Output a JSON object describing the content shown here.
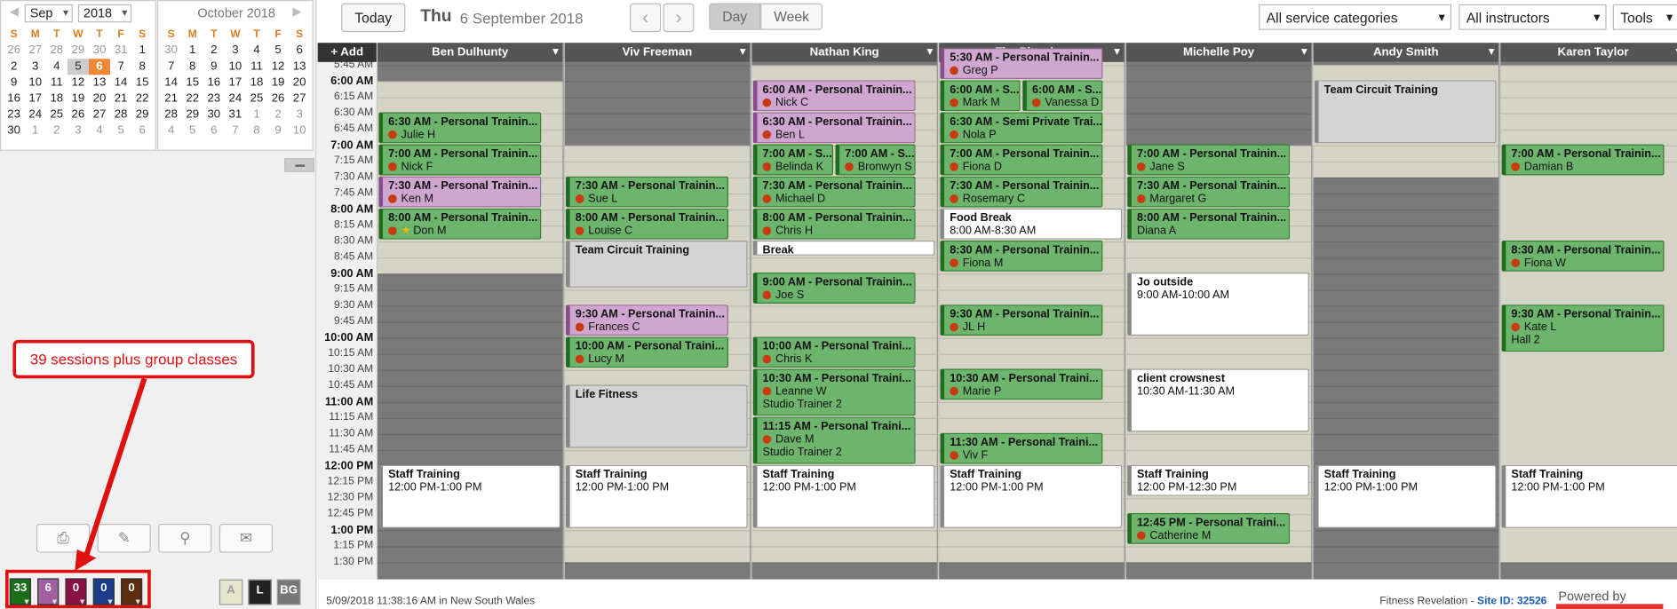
{
  "mini_cal_left": {
    "month": "Sep",
    "year": "2018",
    "dow": [
      "S",
      "M",
      "T",
      "W",
      "T",
      "F",
      "S"
    ],
    "days": [
      "26",
      "27",
      "28",
      "29",
      "30",
      "31",
      "1",
      "2",
      "3",
      "4",
      "5",
      "6",
      "7",
      "8",
      "9",
      "10",
      "11",
      "12",
      "13",
      "14",
      "15",
      "16",
      "17",
      "18",
      "19",
      "20",
      "21",
      "22",
      "23",
      "24",
      "25",
      "26",
      "27",
      "28",
      "29",
      "30",
      "1",
      "2",
      "3",
      "4",
      "5",
      "6"
    ]
  },
  "mini_cal_right": {
    "title": "October 2018",
    "dow": [
      "S",
      "M",
      "T",
      "W",
      "T",
      "F",
      "S"
    ],
    "days": [
      "30",
      "1",
      "2",
      "3",
      "4",
      "5",
      "6",
      "7",
      "8",
      "9",
      "10",
      "11",
      "12",
      "13",
      "14",
      "15",
      "16",
      "17",
      "18",
      "19",
      "20",
      "21",
      "22",
      "23",
      "24",
      "25",
      "26",
      "27",
      "28",
      "29",
      "30",
      "31",
      "1",
      "2",
      "3",
      "4",
      "5",
      "6",
      "7",
      "8",
      "9",
      "10"
    ]
  },
  "tool_icons": [
    "print-icon",
    "edit-icon",
    "search-icon",
    "mail-icon"
  ],
  "counts": [
    {
      "value": "33",
      "color": "#1a6e1a"
    },
    {
      "value": "6",
      "color": "#a060a0"
    },
    {
      "value": "0",
      "color": "#8a1044"
    },
    {
      "value": "0",
      "color": "#1a3c8a"
    },
    {
      "value": "0",
      "color": "#5a2e0e"
    }
  ],
  "legend": [
    {
      "label": "A",
      "bg": "#e6e6cc",
      "fg": "#999"
    },
    {
      "label": "L",
      "bg": "#222",
      "fg": "#fff"
    },
    {
      "label": "BG",
      "bg": "#777",
      "fg": "#fff"
    }
  ],
  "callout": "39 sessions plus group classes",
  "toolbar": {
    "today": "Today",
    "day_name": "Thu",
    "date": "6 September 2018",
    "view_day": "Day",
    "view_week": "Week",
    "service_categories": "All service categories",
    "instructors": "All instructors",
    "tools": "Tools"
  },
  "add_label": "+ Add",
  "instructors": [
    "Ben Dulhunty",
    "Viv Freeman",
    "Nathan King",
    "Tim Pittorino",
    "Michelle Poy",
    "Andy Smith",
    "Karen Taylor"
  ],
  "times": [
    "5:45 AM",
    "6:00 AM",
    "6:15 AM",
    "6:30 AM",
    "6:45 AM",
    "7:00 AM",
    "7:15 AM",
    "7:30 AM",
    "7:45 AM",
    "8:00 AM",
    "8:15 AM",
    "8:30 AM",
    "8:45 AM",
    "9:00 AM",
    "9:15 AM",
    "9:30 AM",
    "9:45 AM",
    "10:00 AM",
    "10:15 AM",
    "10:30 AM",
    "10:45 AM",
    "11:00 AM",
    "11:15 AM",
    "11:30 AM",
    "11:45 AM",
    "12:00 PM",
    "12:15 PM",
    "12:30 PM",
    "12:45 PM",
    "1:00 PM",
    "1:15 PM",
    "1:30 PM"
  ],
  "events": [
    {
      "col": 0,
      "title": "6:30 AM - Personal Trainin...",
      "client": "Julie H",
      "style": "green"
    },
    {
      "col": 0,
      "title": "7:00 AM - Personal Trainin...",
      "client": "Nick F",
      "style": "green"
    },
    {
      "col": 0,
      "title": "7:30 AM - Personal Trainin...",
      "client": "Ken M",
      "style": "purple"
    },
    {
      "col": 0,
      "title": "8:00 AM - Personal Trainin...",
      "client": "Don M",
      "style": "green",
      "star": true
    },
    {
      "col": 0,
      "title": "Staff Training",
      "client": "12:00 PM-1:00 PM",
      "style": "white",
      "nodot": true
    },
    {
      "col": 1,
      "title": "7:30 AM - Personal Trainin...",
      "client": "Sue L",
      "style": "green"
    },
    {
      "col": 1,
      "title": "8:00 AM - Personal Trainin...",
      "client": "Louise C",
      "style": "green"
    },
    {
      "col": 1,
      "title": "Team Circuit Training",
      "client": "",
      "style": "grey",
      "nodot": true
    },
    {
      "col": 1,
      "title": "9:30 AM - Personal Trainin...",
      "client": "Frances C",
      "style": "purple"
    },
    {
      "col": 1,
      "title": "10:00 AM - Personal Traini...",
      "client": "Lucy M",
      "style": "green"
    },
    {
      "col": 1,
      "title": "Life Fitness",
      "client": "",
      "style": "grey",
      "nodot": true
    },
    {
      "col": 1,
      "title": "Staff Training",
      "client": "12:00 PM-1:00 PM",
      "style": "white",
      "nodot": true
    },
    {
      "col": 2,
      "title": "6:00 AM - Personal Trainin...",
      "client": "Nick C",
      "style": "purple"
    },
    {
      "col": 2,
      "title": "6:30 AM - Personal Trainin...",
      "client": "Ben L",
      "style": "purple"
    },
    {
      "col": 2,
      "title": "7:00 AM - S...",
      "client": "Belinda K",
      "style": "green"
    },
    {
      "col": 2,
      "title": "7:00 AM - S...",
      "client": "Bronwyn S",
      "style": "green"
    },
    {
      "col": 2,
      "title": "7:30 AM - Personal Trainin...",
      "client": "Michael D",
      "style": "green"
    },
    {
      "col": 2,
      "title": "8:00 AM - Personal Trainin...",
      "client": "Chris H",
      "style": "green"
    },
    {
      "col": 2,
      "title": "Break",
      "client": "",
      "style": "white",
      "nodot": true
    },
    {
      "col": 2,
      "title": "9:00 AM - Personal Trainin...",
      "client": "Joe S",
      "style": "green"
    },
    {
      "col": 2,
      "title": "10:00 AM - Personal Traini...",
      "client": "Chris K",
      "style": "green"
    },
    {
      "col": 2,
      "title": "10:30 AM - Personal Traini...",
      "client": "Leanne W",
      "extra": "Studio Trainer 2",
      "style": "green"
    },
    {
      "col": 2,
      "title": "11:15 AM - Personal Traini...",
      "client": "Dave M",
      "extra": "Studio Trainer 2",
      "style": "green"
    },
    {
      "col": 2,
      "title": "Staff Training",
      "client": "12:00 PM-1:00 PM",
      "style": "white",
      "nodot": true
    },
    {
      "col": 3,
      "title": "5:30 AM - Personal Trainin...",
      "client": "Greg P",
      "style": "purple"
    },
    {
      "col": 3,
      "title": "6:00 AM - S...",
      "client": "Mark M",
      "style": "green"
    },
    {
      "col": 3,
      "title": "6:00 AM - S...",
      "client": "Vanessa D",
      "style": "green"
    },
    {
      "col": 3,
      "title": "6:30 AM - Semi Private Trai...",
      "client": "Nola P",
      "style": "green"
    },
    {
      "col": 3,
      "title": "7:00 AM - Personal Trainin...",
      "client": "Fiona D",
      "style": "green"
    },
    {
      "col": 3,
      "title": "7:30 AM - Personal Trainin...",
      "client": "Rosemary C",
      "style": "green"
    },
    {
      "col": 3,
      "title": "Food Break",
      "client": "8:00 AM-8:30 AM",
      "style": "white",
      "nodot": true
    },
    {
      "col": 3,
      "title": "8:30 AM - Personal Trainin...",
      "client": "Fiona M",
      "style": "green"
    },
    {
      "col": 3,
      "title": "9:30 AM - Personal Trainin...",
      "client": "JL H",
      "style": "green"
    },
    {
      "col": 3,
      "title": "10:30 AM - Personal Traini...",
      "client": "Marie P",
      "style": "green"
    },
    {
      "col": 3,
      "title": "11:30 AM - Personal Traini...",
      "client": "Viv F",
      "style": "green"
    },
    {
      "col": 3,
      "title": "Staff Training",
      "client": "12:00 PM-1:00 PM",
      "style": "white",
      "nodot": true
    },
    {
      "col": 4,
      "title": "7:00 AM - Personal Trainin...",
      "client": "Jane S",
      "style": "green"
    },
    {
      "col": 4,
      "title": "7:30 AM - Personal Trainin...",
      "client": "Margaret G",
      "style": "green"
    },
    {
      "col": 4,
      "title": "8:00 AM - Personal Trainin...",
      "client": "Diana A",
      "style": "green",
      "nodot": true
    },
    {
      "col": 4,
      "title": "Jo outside",
      "client": "9:00 AM-10:00 AM",
      "style": "white",
      "nodot": true
    },
    {
      "col": 4,
      "title": "client crowsnest",
      "client": "10:30 AM-11:30 AM",
      "style": "white",
      "nodot": true
    },
    {
      "col": 4,
      "title": "Staff Training",
      "client": "12:00 PM-12:30 PM",
      "style": "white",
      "nodot": true
    },
    {
      "col": 4,
      "title": "12:45 PM - Personal Traini...",
      "client": "Catherine M",
      "style": "green"
    },
    {
      "col": 5,
      "title": "Team Circuit Training",
      "client": "",
      "style": "grey",
      "nodot": true
    },
    {
      "col": 5,
      "title": "Staff Training",
      "client": "12:00 PM-1:00 PM",
      "style": "white",
      "nodot": true
    },
    {
      "col": 6,
      "title": "7:00 AM - Personal Trainin...",
      "client": "Damian B",
      "style": "green"
    },
    {
      "col": 6,
      "title": "8:30 AM - Personal Trainin...",
      "client": "Fiona W",
      "style": "green"
    },
    {
      "col": 6,
      "title": "9:30 AM - Personal Trainin...",
      "client": "Kate L",
      "extra": "Hall 2",
      "style": "green"
    },
    {
      "col": 6,
      "title": "Staff Training",
      "client": "12:00 PM-1:00 PM",
      "style": "white",
      "nodot": true
    }
  ],
  "footer": {
    "timestamp": "5/09/2018 11:38:16 AM in New South Wales",
    "business": "Fitness Revelation - ",
    "site_id": "Site ID: 32526",
    "powered": "Powered by"
  }
}
